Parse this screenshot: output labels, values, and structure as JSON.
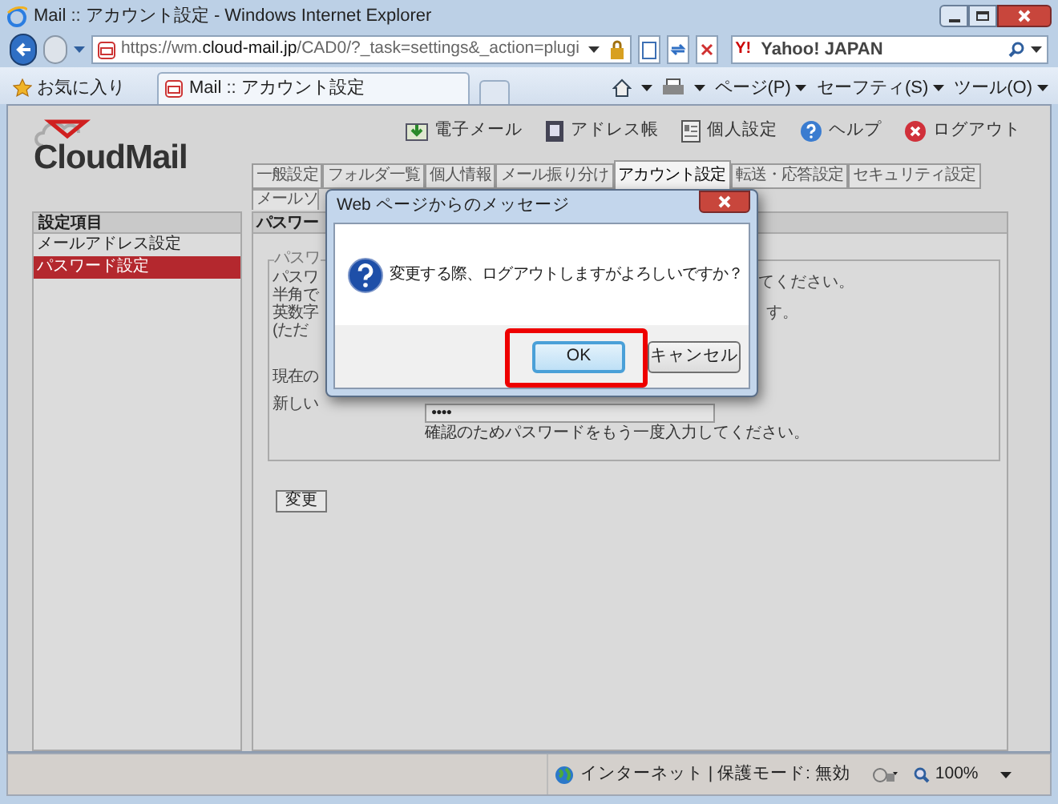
{
  "window": {
    "title": "Mail :: アカウント設定 - Windows Internet Explorer"
  },
  "address_bar": {
    "url_prefix": "https://wm.",
    "url_host": "cloud-mail.jp",
    "url_path": "/CAD0/?_task=settings&_action=plugi"
  },
  "search": {
    "provider_mark": "Y!",
    "placeholder": "Yahoo! JAPAN"
  },
  "command_bar": {
    "favorites": "お気に入り",
    "tabs": [
      {
        "label": "Mail :: アカウント設定",
        "selected": true
      }
    ],
    "menus": [
      "ページ(P)",
      "セーフティ(S)",
      "ツール(O)"
    ]
  },
  "page": {
    "logo": "CloudMail",
    "header_links": [
      {
        "kind": "mail",
        "label": "電子メール"
      },
      {
        "kind": "contacts",
        "label": "アドレス帳"
      },
      {
        "kind": "personal",
        "label": "個人設定"
      },
      {
        "kind": "help",
        "label": "ヘルプ"
      },
      {
        "kind": "logout",
        "label": "ログアウト"
      }
    ],
    "tabs": [
      {
        "label": "一般設定",
        "selected": false
      },
      {
        "label": "フォルダ一覧",
        "selected": false
      },
      {
        "label": "個人情報",
        "selected": false
      },
      {
        "label": "メール振り分け",
        "selected": false
      },
      {
        "label": "アカウント設定",
        "selected": true
      },
      {
        "label": "転送・応答設定",
        "selected": false
      },
      {
        "label": "セキュリティ設定",
        "selected": false
      }
    ],
    "subtab": "メールソ",
    "sidebar": {
      "title": "設定項目",
      "items": [
        {
          "label": "メールアドレス設定",
          "selected": false
        },
        {
          "label": "パスワード設定",
          "selected": true
        }
      ]
    },
    "panel": {
      "title": "パスワー",
      "legend": "パスワ",
      "lines": [
        "パスワ",
        "半角で",
        "英数字",
        "(ただ"
      ],
      "right_texts": [
        "てください。",
        "す。"
      ],
      "field_labels": [
        "現在の",
        "新しい"
      ],
      "confirm_value": "●●●●",
      "confirm_hint": "確認のためパスワードをもう一度入力してください。",
      "submit": "変更"
    }
  },
  "dialog": {
    "title": "Web ページからのメッセージ",
    "message": "変更する際、ログアウトしますがよろしいですか？",
    "buttons": [
      {
        "label": "OK",
        "selected": true
      },
      {
        "label": "キャンセル",
        "selected": false
      }
    ]
  },
  "status_bar": {
    "zone": "インターネット | 保護モード: 無効",
    "zoom": "100%"
  }
}
